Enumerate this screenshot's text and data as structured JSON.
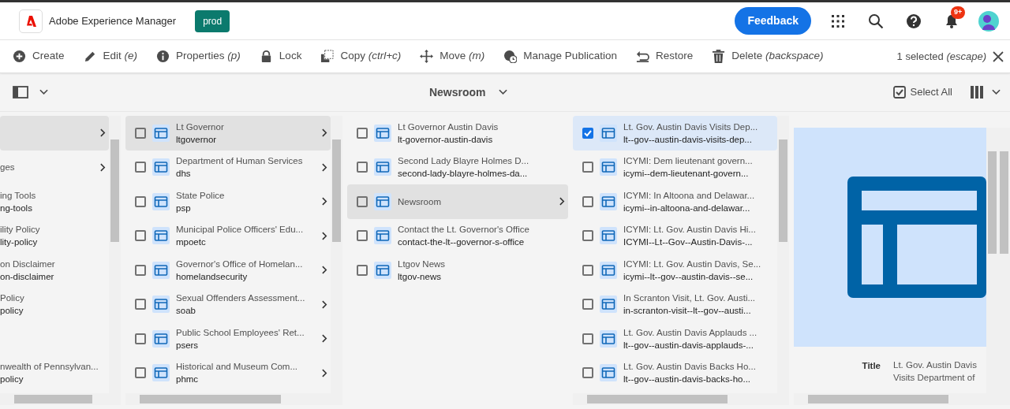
{
  "header": {
    "product": "Adobe Experience Manager",
    "environment": "prod",
    "feedback": "Feedback",
    "notifications": "9+"
  },
  "toolbar": {
    "actions": [
      {
        "label": "Create"
      },
      {
        "label": "Edit",
        "shortcut": "(e)"
      },
      {
        "label": "Properties",
        "shortcut": "(p)"
      },
      {
        "label": "Lock"
      },
      {
        "label": "Copy",
        "shortcut": "(ctrl+c)"
      },
      {
        "label": "Move",
        "shortcut": "(m)"
      },
      {
        "label": "Manage Publication"
      },
      {
        "label": "Restore"
      },
      {
        "label": "Delete",
        "shortcut": "(backspace)"
      }
    ],
    "selection": "1 selected",
    "selection_shortcut": "(escape)"
  },
  "subheader": {
    "title": "Newsroom",
    "select_all": "Select All"
  },
  "columns": [
    {
      "kind": "clipped",
      "scrollable": true,
      "items": [
        {
          "selected": true,
          "expandable": true
        },
        {
          "title": "ges",
          "selected": false,
          "expandable": true
        },
        {
          "title": "ing Tools",
          "name": "ng-tools",
          "selected": false,
          "expandable": false
        },
        {
          "title": "ility Policy",
          "name": "lity-policy",
          "selected": false,
          "expandable": false
        },
        {
          "title": "on Disclaimer",
          "name": "on-disclaimer",
          "selected": false,
          "expandable": false
        },
        {
          "title": "Policy",
          "name": "policy",
          "selected": false,
          "expandable": false
        },
        {
          "title": "nwealth of Pennsylvan...",
          "name": "policy",
          "selected": false,
          "expandable": false,
          "after_gap": true
        }
      ]
    },
    {
      "kind": "full",
      "scrollable": true,
      "items": [
        {
          "title": "Lt Governor",
          "name": "ltgovernor",
          "selected": true,
          "checked": false,
          "expandable": true
        },
        {
          "title": "Department of Human Services",
          "name": "dhs",
          "selected": false,
          "checked": false,
          "expandable": true
        },
        {
          "title": "State Police",
          "name": "psp",
          "selected": false,
          "checked": false,
          "expandable": true
        },
        {
          "title": "Municipal Police Officers' Edu...",
          "name": "mpoetc",
          "selected": false,
          "checked": false,
          "expandable": true
        },
        {
          "title": "Governor's Office of Homelan...",
          "name": "homelandsecurity",
          "selected": false,
          "checked": false,
          "expandable": true
        },
        {
          "title": "Sexual Offenders Assessment...",
          "name": "soab",
          "selected": false,
          "checked": false,
          "expandable": true
        },
        {
          "title": "Public School Employees' Ret...",
          "name": "psers",
          "selected": false,
          "checked": false,
          "expandable": true
        },
        {
          "title": "Historical and Museum Com...",
          "name": "phmc",
          "selected": false,
          "checked": false,
          "expandable": true
        }
      ]
    },
    {
      "kind": "full",
      "scrollable": false,
      "items": [
        {
          "title": "Lt Governor Austin Davis",
          "name": "lt-governor-austin-davis",
          "selected": false,
          "checked": false,
          "expandable": false
        },
        {
          "title": "Second Lady Blayre Holmes D...",
          "name": "second-lady-blayre-holmes-da...",
          "selected": false,
          "checked": false,
          "expandable": false
        },
        {
          "title": "Newsroom",
          "selected": true,
          "checked": false,
          "expandable": true
        },
        {
          "title": "Contact the Lt. Governor's Office",
          "name": "contact-the-lt--governor-s-office",
          "selected": false,
          "checked": false,
          "expandable": false
        },
        {
          "title": "Ltgov News",
          "name": "ltgov-news",
          "selected": false,
          "checked": false,
          "expandable": false
        }
      ]
    },
    {
      "kind": "full",
      "scrollable": true,
      "items": [
        {
          "title": "Lt. Gov. Austin Davis Visits Dep...",
          "name": "lt--gov--austin-davis-visits-dep...",
          "selected": true,
          "checked": true,
          "expandable": false
        },
        {
          "title": "ICYMI: Dem lieutenant govern...",
          "name": "icymi--dem-lieutenant-govern...",
          "selected": false,
          "checked": false,
          "expandable": false
        },
        {
          "title": "ICYMI: In Altoona and Delawar...",
          "name": "icymi--in-altoona-and-delawar...",
          "selected": false,
          "checked": false,
          "expandable": false
        },
        {
          "title": "ICYMI: Lt. Gov. Austin Davis Hi...",
          "name": "ICYMI--Lt--Gov--Austin-Davis-...",
          "selected": false,
          "checked": false,
          "expandable": false
        },
        {
          "title": "ICYMI: Lt. Gov. Austin Davis, Se...",
          "name": "icymi--lt--gov--austin-davis--se...",
          "selected": false,
          "checked": false,
          "expandable": false
        },
        {
          "title": "In Scranton Visit, Lt. Gov. Austi...",
          "name": "in-scranton-visit--lt--gov--austi...",
          "selected": false,
          "checked": false,
          "expandable": false
        },
        {
          "title": "Lt. Gov. Austin Davis Applauds ...",
          "name": "lt--gov--austin-davis-applauds-...",
          "selected": false,
          "checked": false,
          "expandable": false
        },
        {
          "title": "Lt. Gov. Austin Davis Backs Ho...",
          "name": "lt--gov--austin-davis-backs-ho...",
          "selected": false,
          "checked": false,
          "expandable": false
        }
      ]
    }
  ],
  "preview": {
    "label": "Title",
    "value": "Lt. Gov. Austin Davis Visits Department of"
  }
}
